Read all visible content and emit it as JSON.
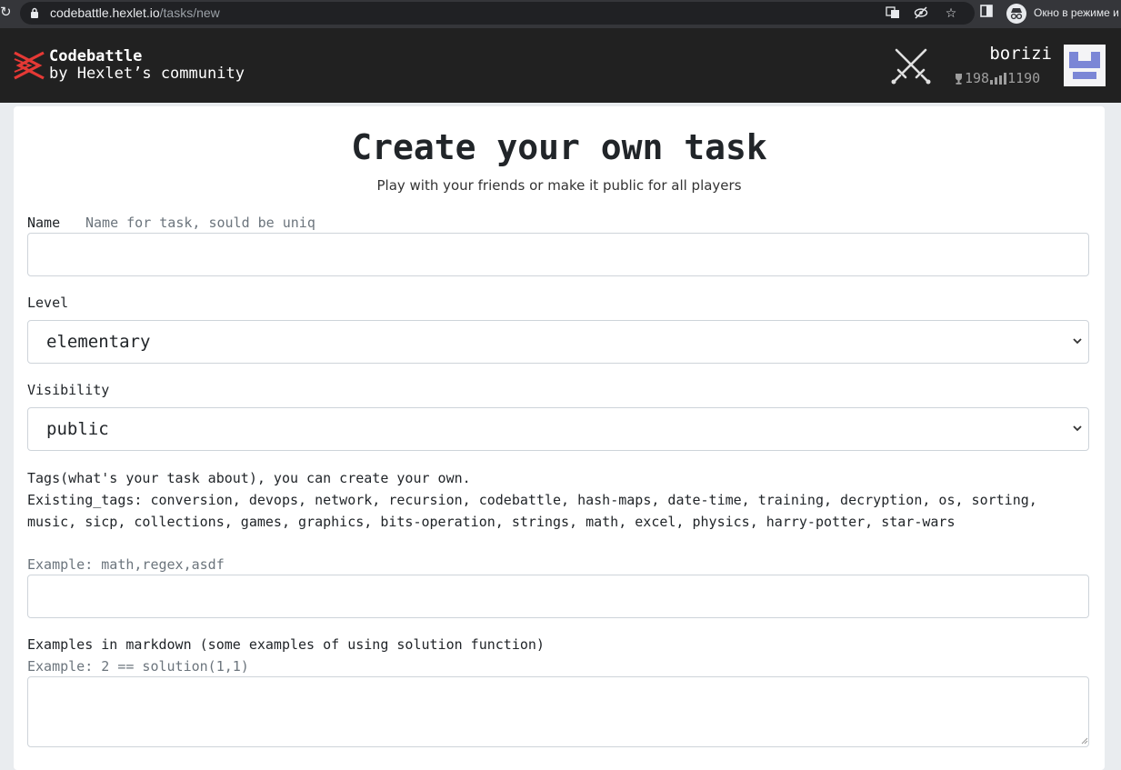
{
  "browser": {
    "url_host": "codebattle.hexlet.io",
    "url_path": "/tasks/new",
    "incognito_label": "Окно в режиме и"
  },
  "header": {
    "brand_title": "Codebattle",
    "brand_subtitle": "by Hexlet’s community",
    "username": "borizi",
    "trophy_count": "198",
    "rating": "1190",
    "logo_color": "#e53935"
  },
  "page": {
    "title": "Create your own task",
    "subtitle": "Play with your friends or make it public for all players"
  },
  "form": {
    "name_label": "Name",
    "name_hint": "Name for task, sould be uniq",
    "name_value": "",
    "level_label": "Level",
    "level_value": "elementary",
    "visibility_label": "Visibility",
    "visibility_value": "public",
    "tags_label": "Tags(what's your task about), you can create your own.",
    "existing_tags_prefix": "Existing_tags: ",
    "existing_tags": "conversion, devops, network, recursion, codebattle, hash-maps, date-time, training, decryption, os, sorting, music, sicp, collections, games, graphics, bits-operation, strings, math, excel, physics, harry-potter, star-wars",
    "tags_example": "Example: math,regex,asdf",
    "tags_value": "",
    "examples_label": "Examples in markdown (some examples of using solution function)",
    "examples_hint": "Example: 2 == solution(1,1)",
    "examples_value": ""
  },
  "annotation": {
    "underline_color": "#d32f2f"
  }
}
